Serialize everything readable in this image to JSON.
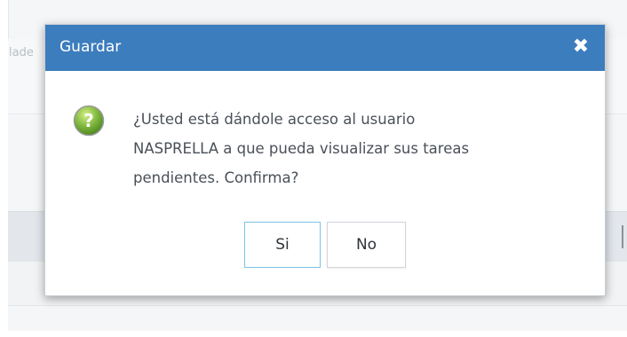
{
  "background": {
    "tab_fragment": "lade"
  },
  "dialog": {
    "title": "Guardar",
    "close_glyph": "✖",
    "message_line_1": "¿Usted está dándole acceso al usuario",
    "message_line_2": "NASPRELLA a que pueda visualizar sus tareas",
    "message_line_3": "pendientes. Confirma?",
    "buttons": {
      "yes_label": "Si",
      "no_label": "No"
    },
    "icon": "question-icon"
  },
  "colors": {
    "titlebar": "#3c7dbd",
    "primary_button_border": "#7cc3e6",
    "icon_green": "#7cb342"
  }
}
